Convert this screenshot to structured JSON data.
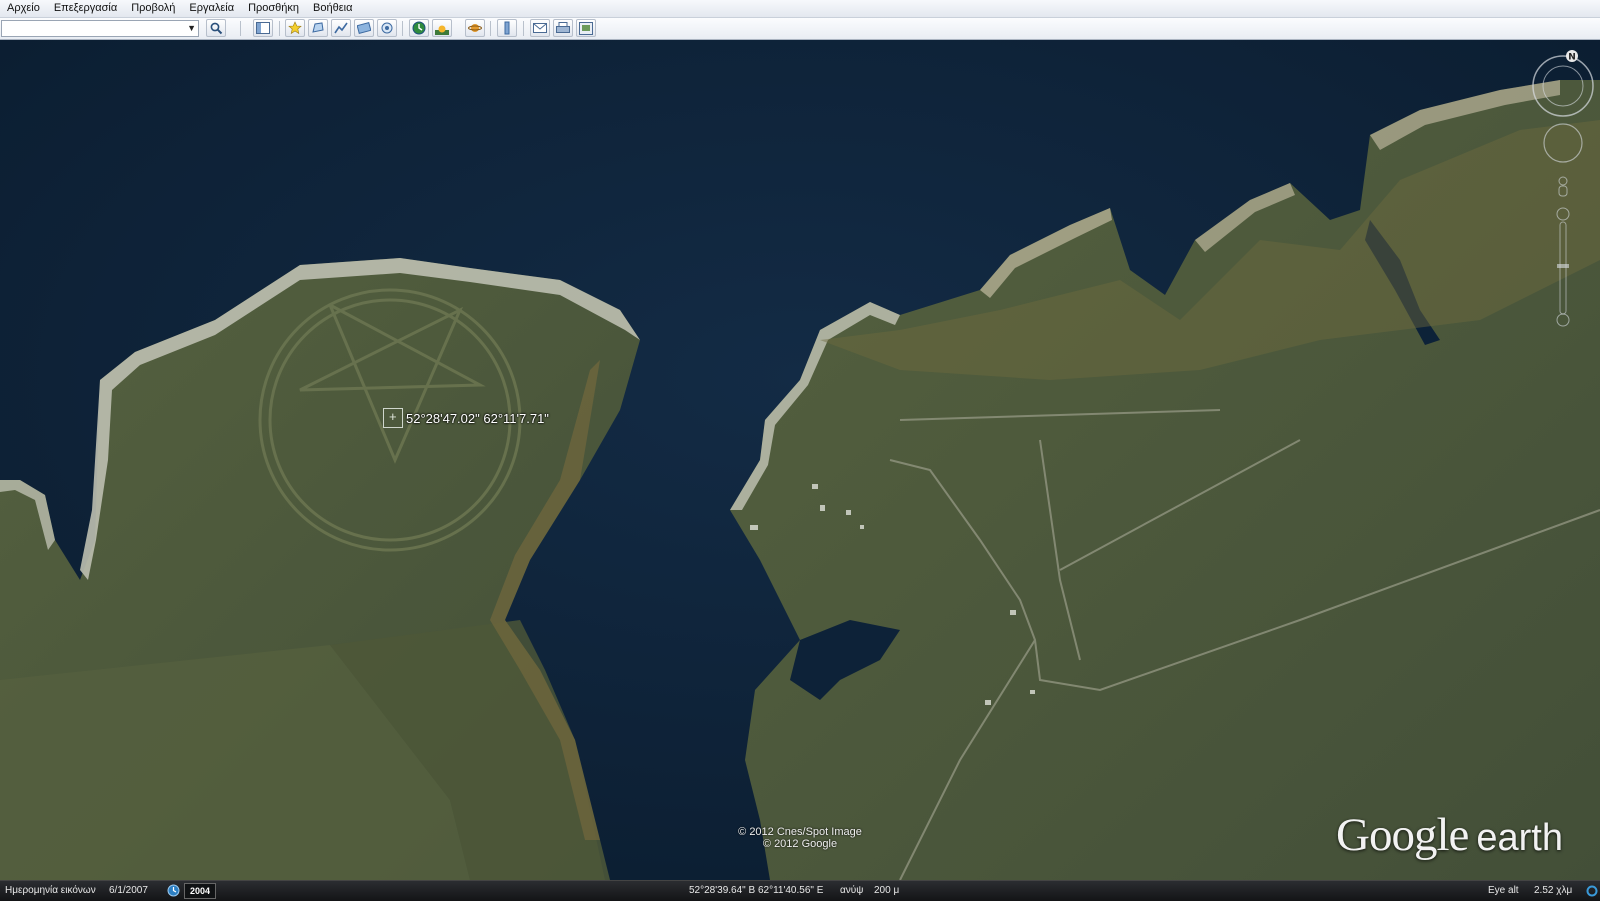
{
  "menu": {
    "items": [
      "Αρχείο",
      "Επεξεργασία",
      "Προβολή",
      "Εργαλεία",
      "Προσθήκη",
      "Βοήθεια"
    ]
  },
  "toolbar": {
    "search_value": "",
    "icons": [
      "sidebar-icon",
      "placemark-icon",
      "polygon-icon",
      "path-icon",
      "image-overlay-icon",
      "record-tour-icon",
      "historical-imagery-icon",
      "sun-icon",
      "planets-icon",
      "ruler-icon",
      "email-icon",
      "print-icon",
      "save-image-icon"
    ]
  },
  "map": {
    "placemark_coords": "52°28'47.02\" 62°11'7.71\"",
    "attribution_line1": "© 2012 Cnes/Spot Image",
    "attribution_line2": "© 2012 Google",
    "logo_google": "Google",
    "logo_earth": "earth",
    "compass_north": "N",
    "colors": {
      "water": "#0d2238",
      "land": "#4a573c",
      "shore": "#cfcfc3"
    }
  },
  "statusbar": {
    "imagery_date_label": "Ημερομηνία εικόνων",
    "imagery_date": "6/1/2007",
    "historical_year": "2004",
    "coordinates": "52°28'39.64\" B  62°11'40.56\" E",
    "elevation_label": "ανύψ",
    "elevation": "200 μ",
    "eye_alt_label": "Eye alt",
    "eye_alt_value": "2.52 χλμ"
  }
}
